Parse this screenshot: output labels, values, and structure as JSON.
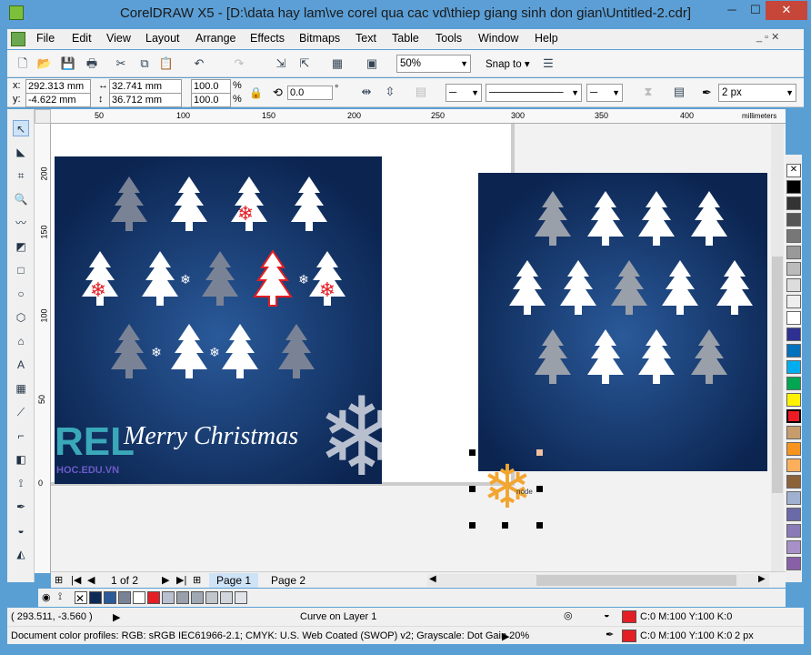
{
  "window": {
    "title": "CorelDRAW X5 - [D:\\data hay lam\\ve corel qua cac vd\\thiep giang sinh don gian\\Untitled-2.cdr]",
    "minimize": "─",
    "maximize": "☐",
    "close": "✕"
  },
  "menu": [
    "File",
    "Edit",
    "View",
    "Layout",
    "Arrange",
    "Effects",
    "Bitmaps",
    "Text",
    "Table",
    "Tools",
    "Window",
    "Help"
  ],
  "toolbar": {
    "zoom_value": "50%",
    "snap_label": "Snap to"
  },
  "props": {
    "x": "292.313 mm",
    "y": "-4.622 mm",
    "w": "32.741 mm",
    "h": "36.712 mm",
    "scale_x": "100.0",
    "scale_y": "100.0",
    "pct": "%",
    "angle": "0.0",
    "deg": "°",
    "outline_width": "2 px"
  },
  "rulers": {
    "h_ticks": [
      "50",
      "100",
      "150",
      "200",
      "250",
      "300",
      "350",
      "400"
    ],
    "unit": "millimeters",
    "v_ticks": [
      "200",
      "150",
      "100",
      "50",
      "0"
    ]
  },
  "card_left": {
    "greeting": "Merry Christmas",
    "logo_text": "REL",
    "logo_sub": "HOC.EDU.VN"
  },
  "selection_label": "node",
  "docnav": {
    "page_count": "1 of 2",
    "tabs": [
      "Page 1",
      "Page 2"
    ]
  },
  "status": {
    "coords": "( 293.511, -3.560 )",
    "object_info": "Curve on Layer 1",
    "fill_spec": "C:0 M:100 Y:100 K:0",
    "outline_spec": "C:0 M:100 Y:100 K:0",
    "outline_size": "2 px",
    "profile_text": "Document color profiles: RGB: sRGB IEC61966-2.1; CMYK: U.S. Web Coated (SWOP) v2; Grayscale: Dot Gain 20%"
  },
  "colors": {
    "card_bg": "#0c2a55",
    "accent_red": "#e31e24",
    "tree_white": "#ffffff",
    "tree_gray": "#8c93a0"
  }
}
